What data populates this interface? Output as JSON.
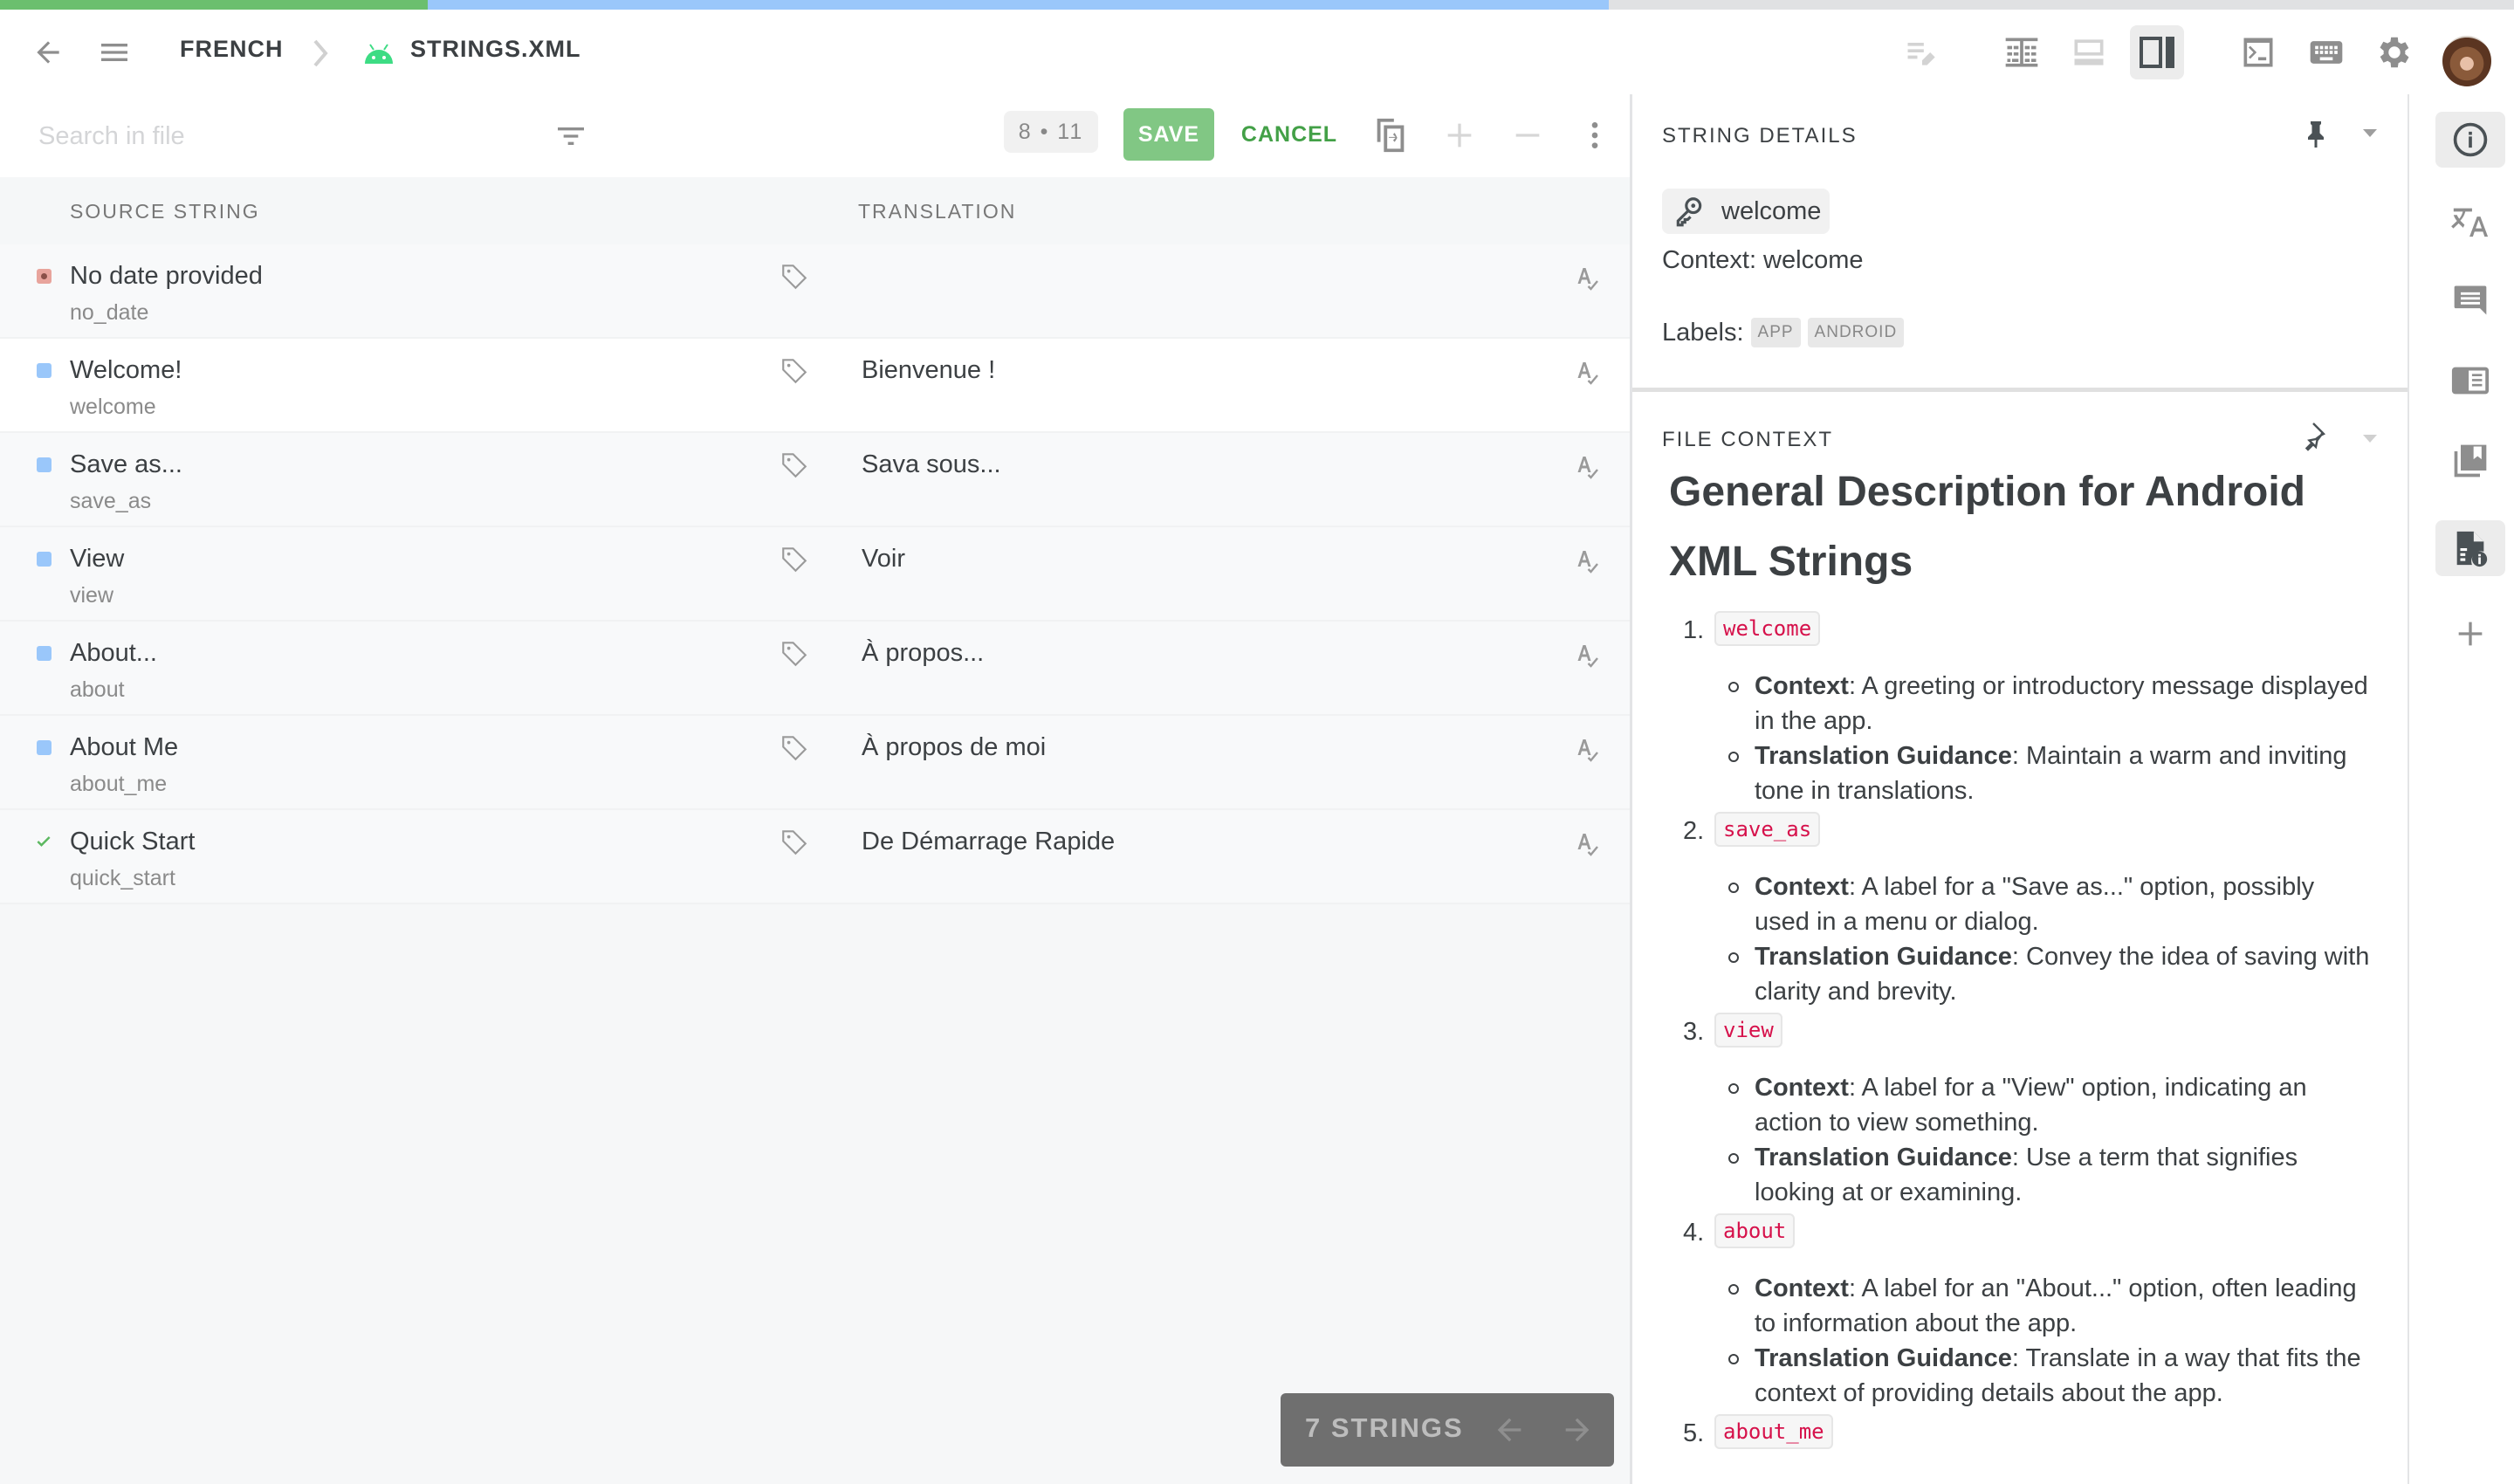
{
  "progress": {
    "segments": [
      {
        "name": "translated",
        "fraction": 0.17,
        "color": "#6bbf6e"
      },
      {
        "name": "in-progress",
        "fraction": 0.47,
        "color": "#9ac7fa"
      },
      {
        "name": "remaining",
        "fraction": 0.36,
        "color": "#e0e1e3"
      }
    ]
  },
  "header": {
    "breadcrumb": [
      "FRENCH",
      "STRINGS.XML"
    ],
    "icons": [
      "edit-notes-icon",
      "side-by-side-icon",
      "bottom-panel-icon",
      "right-panel-icon",
      "terminal-icon",
      "keyboard-icon",
      "gear-icon",
      "avatar"
    ]
  },
  "toolbar": {
    "search_placeholder": "Search in file",
    "search_value": "",
    "counter": "8 • 11",
    "save_label": "SAVE",
    "cancel_label": "CANCEL"
  },
  "table": {
    "columns": [
      "SOURCE STRING",
      "TRANSLATION"
    ],
    "rows": [
      {
        "source": "No date provided",
        "key": "no_date",
        "translation": "",
        "status": "error",
        "status_color": "#e8a49c"
      },
      {
        "source": "Welcome!",
        "key": "welcome",
        "translation": "Bienvenue !",
        "status": "pending",
        "status_color": "#9ac7fa",
        "selected": true
      },
      {
        "source": "Save as...",
        "key": "save_as",
        "translation": "Sava sous...",
        "status": "pending",
        "status_color": "#9ac7fa"
      },
      {
        "source": "View",
        "key": "view",
        "translation": "Voir",
        "status": "pending",
        "status_color": "#9ac7fa"
      },
      {
        "source": "About...",
        "key": "about",
        "translation": "À propos...",
        "status": "pending",
        "status_color": "#9ac7fa"
      },
      {
        "source": "About Me",
        "key": "about_me",
        "translation": "À propos de moi",
        "status": "pending",
        "status_color": "#9ac7fa"
      },
      {
        "source": "Quick Start",
        "key": "quick_start",
        "translation": "De Démarrage Rapide",
        "status": "approved",
        "status_color": "#5cb860"
      }
    ]
  },
  "pager": {
    "label": "7 STRINGS"
  },
  "string_details": {
    "title": "STRING DETAILS",
    "key": "welcome",
    "context": "Context: welcome",
    "labels_prefix": "Labels:",
    "labels": [
      "APP",
      "ANDROID"
    ]
  },
  "file_context": {
    "title": "FILE CONTEXT",
    "heading": "General Description for Android XML Strings",
    "items": [
      {
        "num": "1.",
        "key": "welcome",
        "bullets": [
          {
            "label": "Context",
            "text": ": A greeting or introductory message displayed in the app."
          },
          {
            "label": "Translation Guidance",
            "text": ": Maintain a warm and inviting tone in translations."
          }
        ]
      },
      {
        "num": "2.",
        "key": "save_as",
        "bullets": [
          {
            "label": "Context",
            "text": ": A label for a \"Save as...\" option, possibly used in a menu or dialog."
          },
          {
            "label": "Translation Guidance",
            "text": ": Convey the idea of saving with clarity and brevity."
          }
        ]
      },
      {
        "num": "3.",
        "key": "view",
        "bullets": [
          {
            "label": "Context",
            "text": ": A label for a \"View\" option, indicating an action to view something."
          },
          {
            "label": "Translation Guidance",
            "text": ": Use a term that signifies looking at or examining."
          }
        ]
      },
      {
        "num": "4.",
        "key": "about",
        "bullets": [
          {
            "label": "Context",
            "text": ": A label for an \"About...\" option, often leading to information about the app."
          },
          {
            "label": "Translation Guidance",
            "text": ": Translate in a way that fits the context of providing details about the app."
          }
        ]
      },
      {
        "num": "5.",
        "key": "about_me",
        "bullets": []
      }
    ]
  },
  "rail": {
    "items": [
      "info-icon",
      "translate-icon",
      "comment-icon",
      "glossary-icon",
      "bookmarks-icon",
      "file-info-icon",
      "add-icon"
    ],
    "active": [
      "info-icon",
      "file-info-icon"
    ]
  }
}
